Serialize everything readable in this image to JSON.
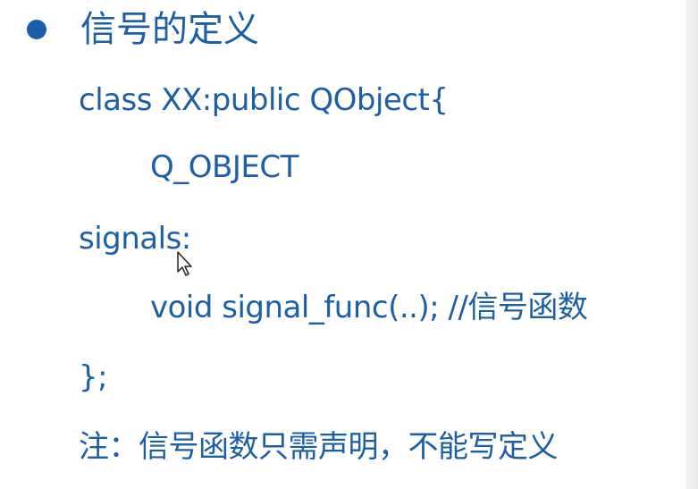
{
  "slide": {
    "title": "信号的定义",
    "code_lines": [
      "class XX:public QObject{",
      "Q_OBJECT",
      "signals:",
      "void signal_func(..); //信号函数",
      "};"
    ],
    "note": "注：信号函数只需声明，不能写定义"
  },
  "colors": {
    "text": "#1d5fa5",
    "bullet": "#1b5ea8",
    "background": "#ffffff"
  },
  "icons": {
    "cursor": "mouse-pointer-icon"
  }
}
